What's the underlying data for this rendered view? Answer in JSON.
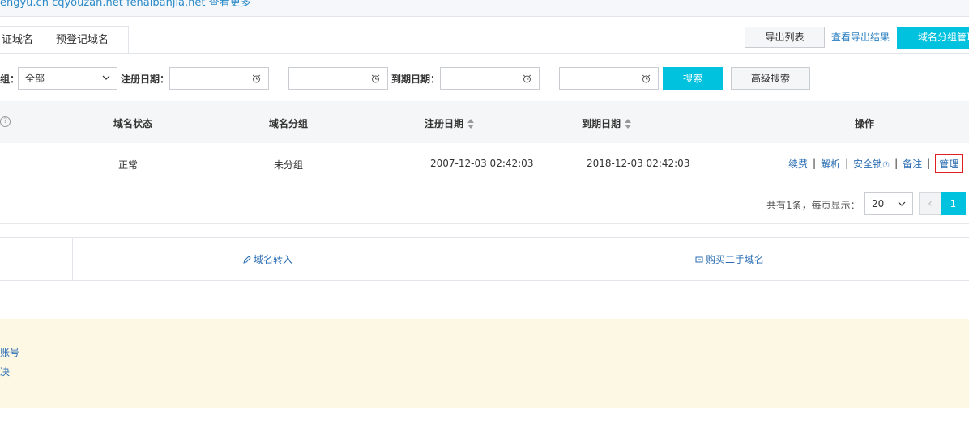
{
  "topbar": {
    "links": "engyu.cn   cqyouzan.net   fenaibanjia.net   查看更多"
  },
  "tabs": [
    {
      "label": "证域名"
    },
    {
      "label": "预登记域名"
    }
  ],
  "toolbar": {
    "export_label": "导出列表",
    "results_label": "查看导出结果",
    "group_mgr_label": "域名分组管理"
  },
  "filters": {
    "group_label": "组：",
    "group_value": "全部",
    "reg_label": "注册日期：",
    "exp_label": "到期日期：",
    "dash": "-",
    "search_label": "搜索",
    "advanced_label": "高级搜索"
  },
  "table": {
    "headers": {
      "status": "域名状态",
      "group": "域名分组",
      "reg_date": "注册日期",
      "exp_date": "到期日期",
      "actions": "操作"
    },
    "rows": [
      {
        "status": "正常",
        "group": "未分组",
        "reg_date": "2007-12-03 02:42:03",
        "exp_date": "2018-12-03 02:42:03",
        "actions": {
          "renew": "续费",
          "resolve": "解析",
          "lock": "安全锁",
          "note": "备注",
          "manage": "管理"
        }
      }
    ]
  },
  "pager": {
    "summary": "共有1条，每页显示：",
    "page_size": "20",
    "prev": "‹",
    "current": "1"
  },
  "action_bar": {
    "transfer_in": "域名转入",
    "buy_second_hand": "购买二手域名"
  },
  "notice": {
    "line1": "账号",
    "line2": "决"
  },
  "colors": {
    "accent": "#00c1de",
    "link": "#2a6db3",
    "notice_bg": "#fdf8e4"
  }
}
